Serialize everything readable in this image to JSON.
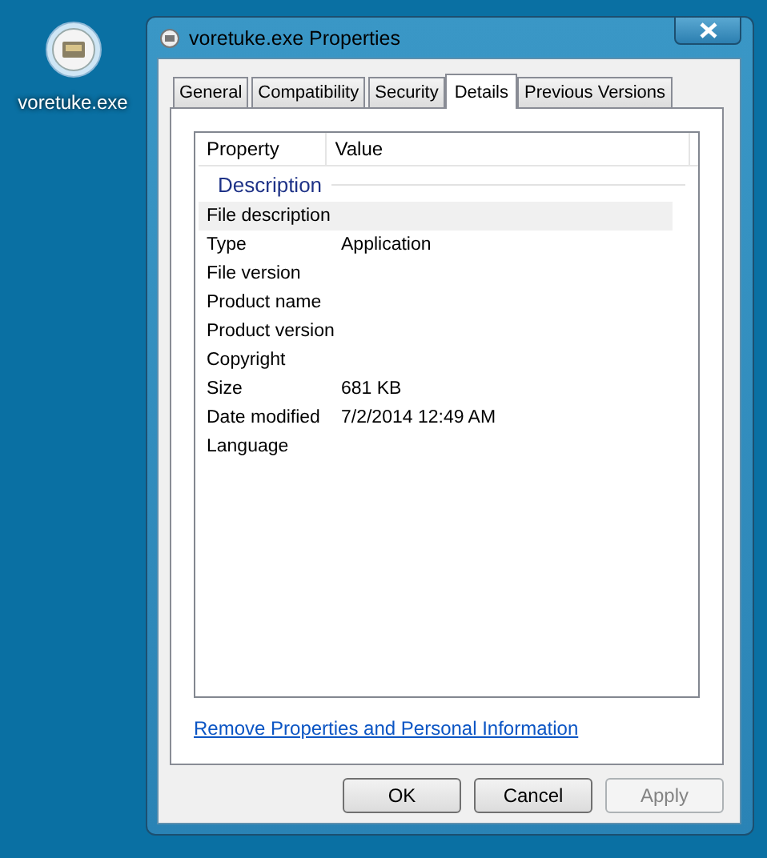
{
  "desktop_icon": {
    "label": "voretuke.exe"
  },
  "window": {
    "title": "voretuke.exe Properties"
  },
  "tabs": [
    {
      "label": "General",
      "selected": false
    },
    {
      "label": "Compatibility",
      "selected": false
    },
    {
      "label": "Security",
      "selected": false
    },
    {
      "label": "Details",
      "selected": true
    },
    {
      "label": "Previous Versions",
      "selected": false
    }
  ],
  "details": {
    "columns": [
      "Property",
      "Value"
    ],
    "group": "Description",
    "rows": [
      {
        "property": "File description",
        "value": "",
        "selected": true
      },
      {
        "property": "Type",
        "value": "Application",
        "selected": false
      },
      {
        "property": "File version",
        "value": "",
        "selected": false
      },
      {
        "property": "Product name",
        "value": "",
        "selected": false
      },
      {
        "property": "Product version",
        "value": "",
        "selected": false
      },
      {
        "property": "Copyright",
        "value": "",
        "selected": false
      },
      {
        "property": "Size",
        "value": "681 KB",
        "selected": false
      },
      {
        "property": "Date modified",
        "value": "7/2/2014 12:49 AM",
        "selected": false
      },
      {
        "property": "Language",
        "value": "",
        "selected": false
      }
    ]
  },
  "link": "Remove Properties and Personal Information",
  "buttons": [
    {
      "label": "OK",
      "disabled": false
    },
    {
      "label": "Cancel",
      "disabled": false
    },
    {
      "label": "Apply",
      "disabled": true
    }
  ]
}
